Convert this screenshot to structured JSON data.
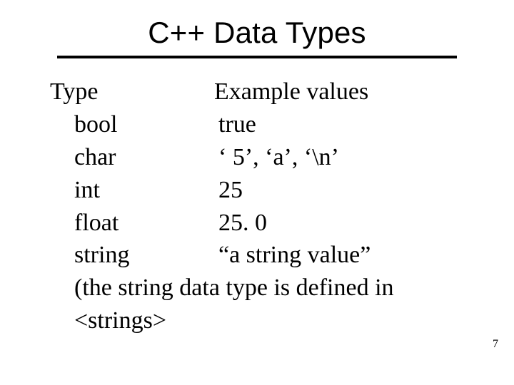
{
  "title": "C++ Data Types",
  "headers": {
    "type": "Type",
    "example": "Example values"
  },
  "rows": [
    {
      "type": "bool",
      "example": "true"
    },
    {
      "type": "char",
      "example": "‘ 5’, ‘a’, ‘\\n’"
    },
    {
      "type": "int",
      "example": "25"
    },
    {
      "type": "float",
      "example": "25. 0"
    },
    {
      "type": "string",
      "example": "“a string value”"
    }
  ],
  "note_line1": "(the string data type is defined in",
  "note_line2": "<strings>",
  "page_number": "7"
}
